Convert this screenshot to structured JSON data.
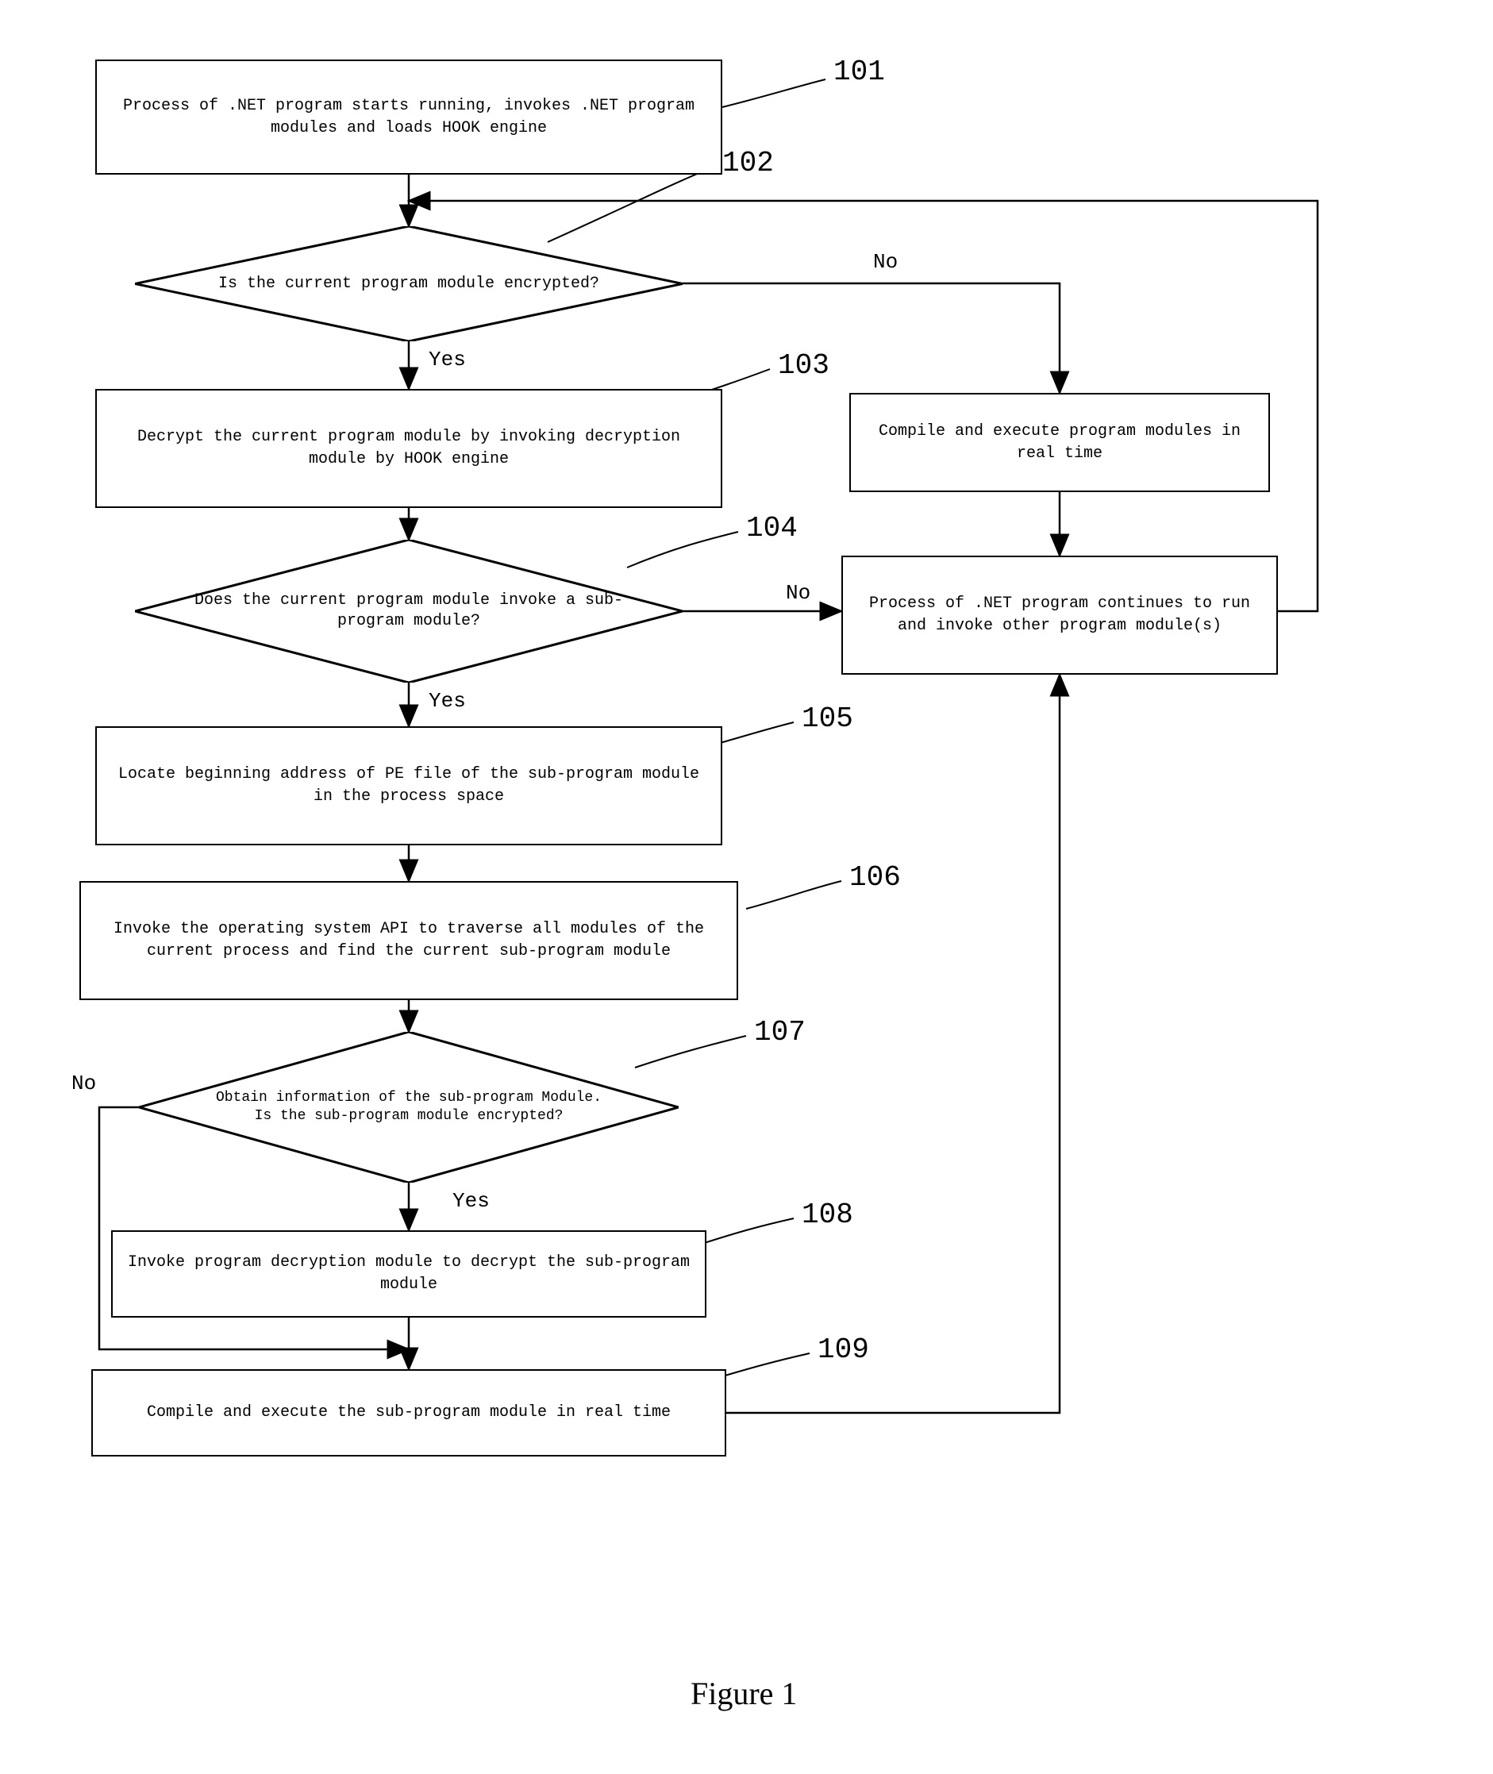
{
  "nodes": {
    "n101": "Process of .NET program starts running, invokes .NET program modules and loads HOOK engine",
    "n102": "Is the current program module encrypted?",
    "n103": "Decrypt the current program module by invoking decryption module by HOOK engine",
    "n104": "Does the current program module invoke a sub-program module?",
    "n105": "Locate beginning address of PE file of the sub-program module in the process space",
    "n106": "Invoke the operating system API to traverse all modules of the current process and find the current sub-program module",
    "n107": "Obtain information of the sub-program Module. Is the sub-program module encrypted?",
    "n108": "Invoke program decryption module to decrypt the sub-program module",
    "n109": "Compile and execute the sub-program module in real time",
    "right1": "Compile and execute program modules in real time",
    "right2": "Process of .NET program continues to run and invoke other program module(s)"
  },
  "labels": {
    "l101": "101",
    "l102": "102",
    "l103": "103",
    "l104": "104",
    "l105": "105",
    "l106": "106",
    "l107": "107",
    "l108": "108",
    "l109": "109"
  },
  "edges": {
    "yes": "Yes",
    "no": "No"
  },
  "caption": "Figure 1"
}
